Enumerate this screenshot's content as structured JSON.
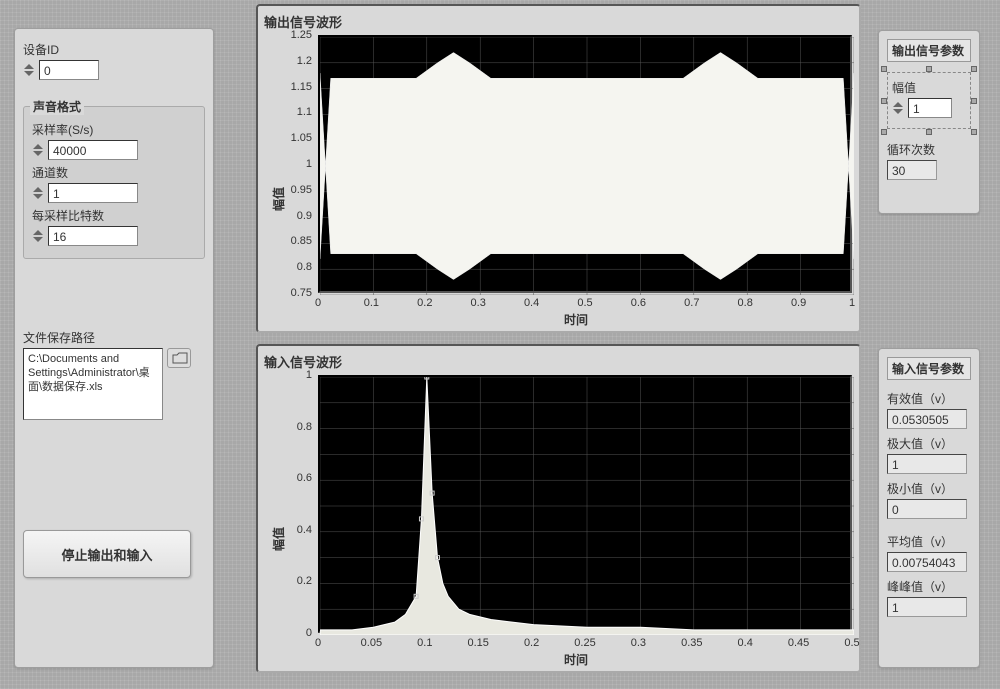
{
  "left_panel": {
    "device_id_label": "设备ID",
    "device_id": "0",
    "sound_format_title": "声音格式",
    "sample_rate_label": "采样率(S/s)",
    "sample_rate": "40000",
    "channels_label": "通道数",
    "channels": "1",
    "bits_label": "每采样比特数",
    "bits": "16",
    "save_path_label": "文件保存路径",
    "save_path": "C:\\Documents and Settings\\Administrator\\桌面\\数据保存.xls",
    "stop_button": "停止输出和输入"
  },
  "output_params": {
    "title": "输出信号参数",
    "amplitude_label": "幅值",
    "amplitude": "1",
    "loops_label": "循环次数",
    "loops": "30"
  },
  "input_params": {
    "title": "输入信号参数",
    "rms_label": "有效值（v）",
    "rms": "0.0530505",
    "max_label": "极大值（v）",
    "max": "1",
    "min_label": "极小值（v）",
    "min": "0",
    "avg_label": "平均值（v）",
    "avg": "0.00754043",
    "pp_label": "峰峰值（v）",
    "pp": "1"
  },
  "chart_output": {
    "title": "输出信号波形",
    "ylabel": "幅值",
    "xlabel": "时间",
    "y_ticks": [
      "0.75",
      "0.8",
      "0.85",
      "0.9",
      "0.95",
      "1",
      "1.05",
      "1.1",
      "1.15",
      "1.2",
      "1.25"
    ],
    "x_ticks": [
      "0",
      "0.1",
      "0.2",
      "0.3",
      "0.4",
      "0.5",
      "0.6",
      "0.7",
      "0.8",
      "0.9",
      "1"
    ]
  },
  "chart_input": {
    "title": "输入信号波形",
    "ylabel": "幅值",
    "xlabel": "时间",
    "y_ticks": [
      "0",
      "0.2",
      "0.4",
      "0.6",
      "0.8",
      "1"
    ],
    "x_ticks": [
      "0",
      "0.05",
      "0.1",
      "0.15",
      "0.2",
      "0.25",
      "0.3",
      "0.35",
      "0.4",
      "0.45",
      "0.5"
    ]
  },
  "chart_data": [
    {
      "type": "line",
      "title": "输出信号波形",
      "xlabel": "时间",
      "ylabel": "幅值",
      "xlim": [
        0,
        1
      ],
      "ylim": [
        0.75,
        1.25
      ],
      "series": [
        {
          "name": "upper_envelope",
          "x": [
            0,
            0.02,
            0.18,
            0.22,
            0.25,
            0.28,
            0.32,
            0.68,
            0.72,
            0.75,
            0.78,
            0.82,
            0.98,
            1
          ],
          "y": [
            0.82,
            1.17,
            1.17,
            1.2,
            1.22,
            1.2,
            1.17,
            1.17,
            1.2,
            1.22,
            1.2,
            1.17,
            1.17,
            0.82
          ]
        },
        {
          "name": "lower_envelope",
          "x": [
            0,
            0.02,
            0.18,
            0.22,
            0.25,
            0.28,
            0.32,
            0.68,
            0.72,
            0.75,
            0.78,
            0.82,
            0.98,
            1
          ],
          "y": [
            1.18,
            0.83,
            0.83,
            0.8,
            0.78,
            0.8,
            0.83,
            0.83,
            0.8,
            0.78,
            0.8,
            0.83,
            0.83,
            1.18
          ]
        }
      ]
    },
    {
      "type": "line",
      "title": "输入信号波形",
      "xlabel": "时间",
      "ylabel": "幅值",
      "xlim": [
        0,
        0.5
      ],
      "ylim": [
        0,
        1
      ],
      "series": [
        {
          "name": "response",
          "x": [
            0,
            0.03,
            0.05,
            0.07,
            0.08,
            0.09,
            0.095,
            0.1,
            0.105,
            0.11,
            0.115,
            0.12,
            0.13,
            0.14,
            0.16,
            0.18,
            0.2,
            0.25,
            0.3,
            0.35,
            0.4,
            0.45,
            0.5
          ],
          "y": [
            0.02,
            0.02,
            0.03,
            0.05,
            0.08,
            0.15,
            0.45,
            1.0,
            0.55,
            0.3,
            0.2,
            0.15,
            0.1,
            0.08,
            0.06,
            0.05,
            0.04,
            0.03,
            0.03,
            0.02,
            0.02,
            0.02,
            0.02
          ]
        }
      ]
    }
  ]
}
